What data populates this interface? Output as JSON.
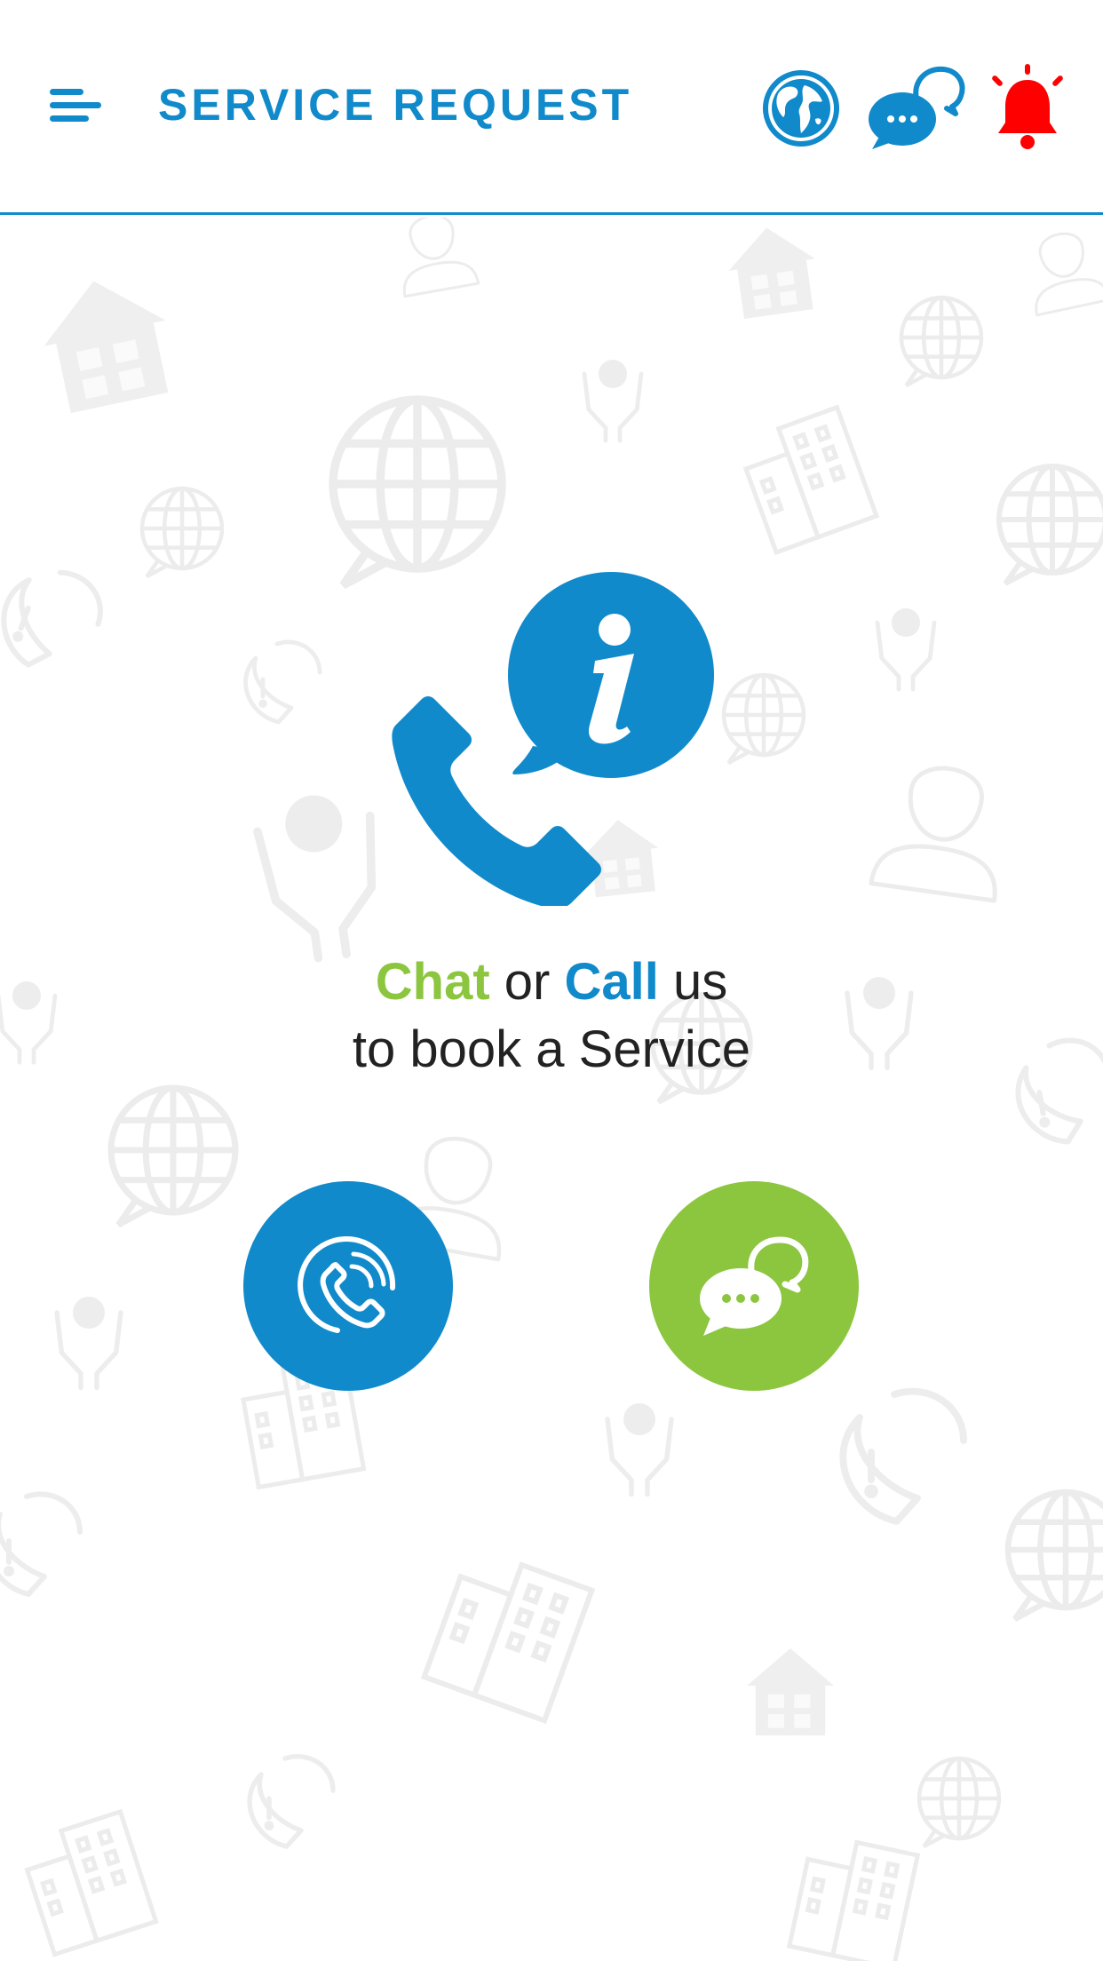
{
  "header": {
    "title": "SERVICE REQUEST",
    "menu_icon": "menu-icon",
    "language_icon": "globe-icon",
    "chat_icon": "chat-bubbles-icon",
    "notification_icon": "bell-icon"
  },
  "main": {
    "hero_icon": "phone-info-icon",
    "tagline": {
      "chat_word": "Chat",
      "or_word": " or ",
      "call_word": "Call",
      "us_word": " us",
      "line2": "to book a Service"
    },
    "call_button_icon": "phone-ringing-icon",
    "chat_button_icon": "chat-bubbles-icon"
  },
  "colors": {
    "primary_blue": "#118acb",
    "accent_green": "#8cc63f",
    "alert_red": "#ff0000",
    "pattern_grey": "#eeeeee"
  }
}
